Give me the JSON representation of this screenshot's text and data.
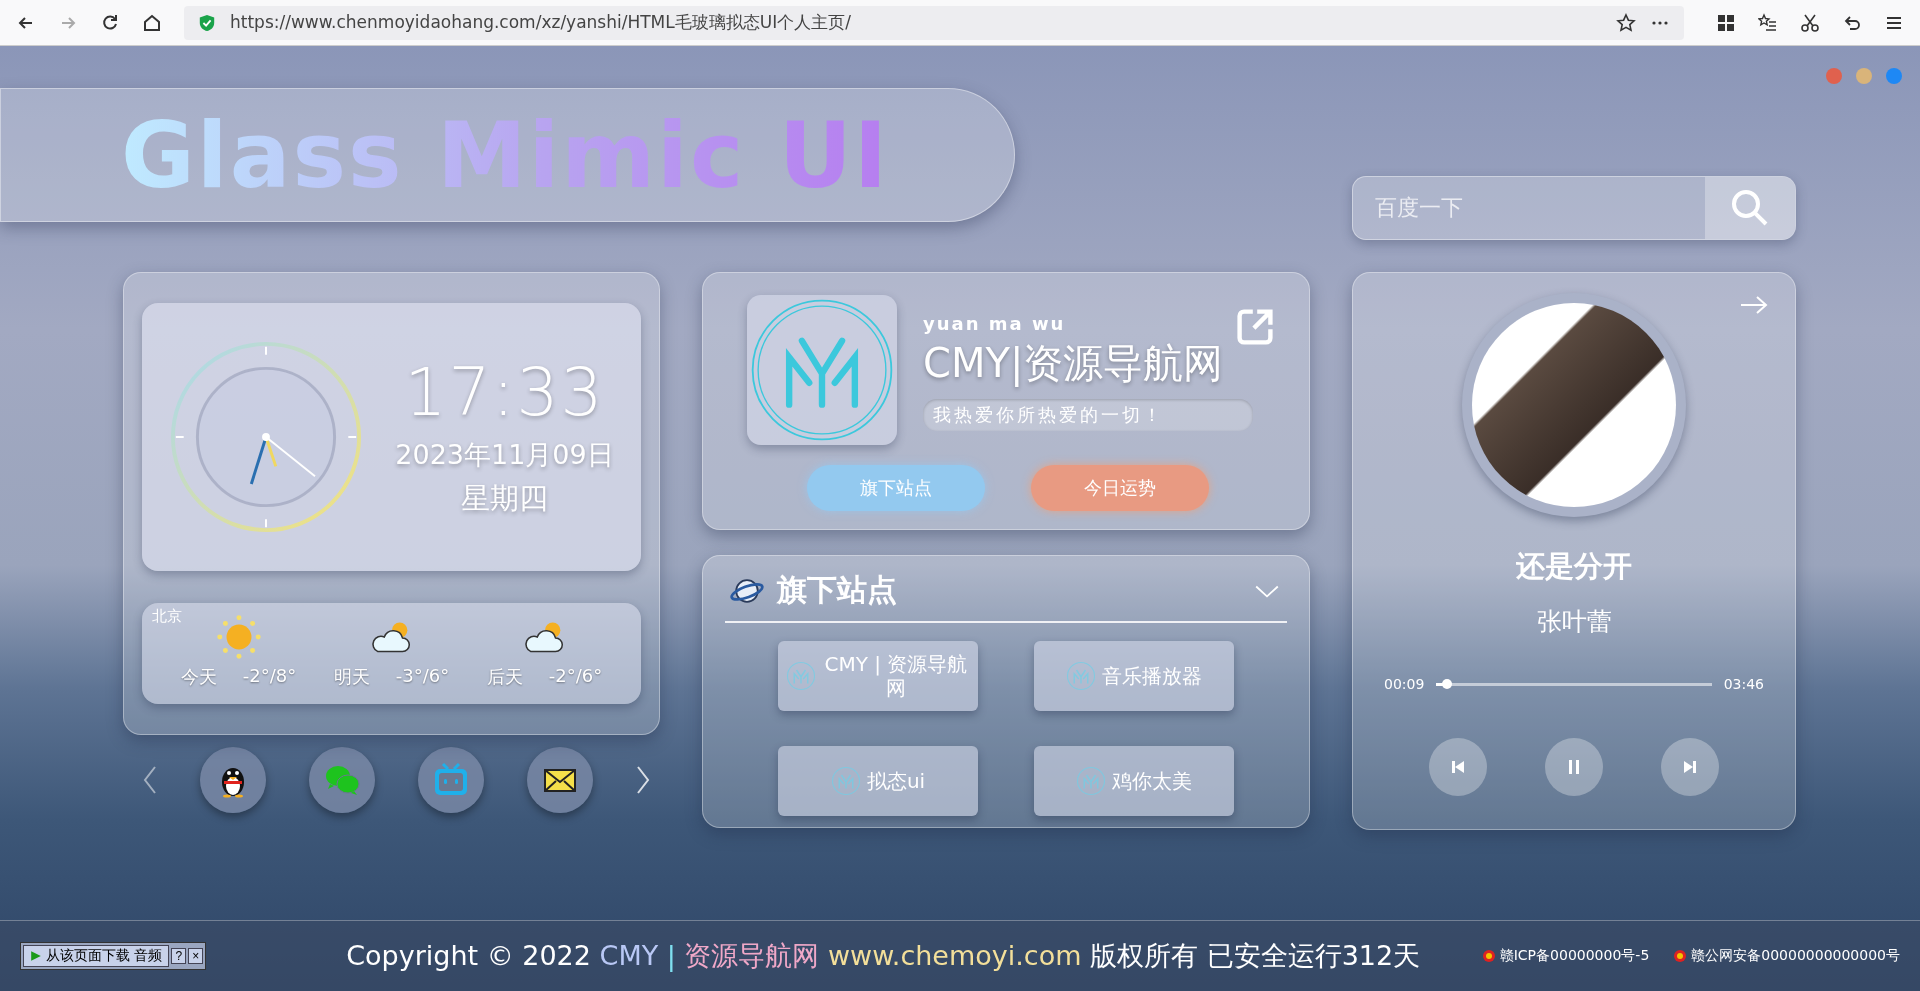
{
  "browser": {
    "url": "https://www.chenmoyidaohang.com/xz/yanshi/HTML毛玻璃拟态UI个人主页/"
  },
  "window_dots": [
    {
      "color": "#e0614e"
    },
    {
      "color": "#d9b47a"
    },
    {
      "color": "#1e88f5"
    }
  ],
  "header": {
    "title": "Glass Mimic UI"
  },
  "search": {
    "placeholder": "百度一下"
  },
  "clock": {
    "time": "17:33",
    "date": "2023年11月09日",
    "weekday": "星期四"
  },
  "weather": {
    "city": "北京",
    "days": [
      {
        "day": "今天",
        "temp": "-2°/8°",
        "kind": "sunny"
      },
      {
        "day": "明天",
        "temp": "-3°/6°",
        "kind": "partly-cloudy"
      },
      {
        "day": "后天",
        "temp": "-2°/6°",
        "kind": "partly-cloudy"
      }
    ]
  },
  "profile": {
    "pinyin": "yuan ma wu",
    "name": "CMY|资源导航网",
    "motto": "我热爱你所热爱的一切！",
    "buttons": [
      {
        "label": "旗下站点",
        "kind": "blue"
      },
      {
        "label": "今日运势",
        "kind": "orange"
      }
    ]
  },
  "sites": {
    "title": "旗下站点",
    "expanded": true,
    "items": [
      {
        "label": "CMY | 资源导航网"
      },
      {
        "label": "音乐播放器"
      },
      {
        "label": "拟态ui"
      },
      {
        "label": "鸡你太美"
      }
    ]
  },
  "player": {
    "song": "还是分开",
    "artist": "张叶蕾",
    "elapsed": "00:09",
    "duration": "03:46",
    "level": 0.04,
    "playing": true
  },
  "footer": {
    "widget": {
      "label": "从该页面下载 音频",
      "help": "?",
      "close": "×"
    },
    "copyright": [
      {
        "text": "Copyright © 2022 ",
        "kind": "plain"
      },
      {
        "text": "CMY",
        "kind": "blue"
      },
      {
        "text": " | ",
        "kind": "cyan"
      },
      {
        "text": "资源导航网",
        "kind": "pink"
      },
      {
        "text": " www.chemoyi.com",
        "kind": "yellow"
      },
      {
        "text": " 版权所有 已安全运行312天",
        "kind": "plain"
      }
    ],
    "records": [
      "赣ICP备00000000号-5",
      "赣公网安备00000000000000号"
    ]
  }
}
